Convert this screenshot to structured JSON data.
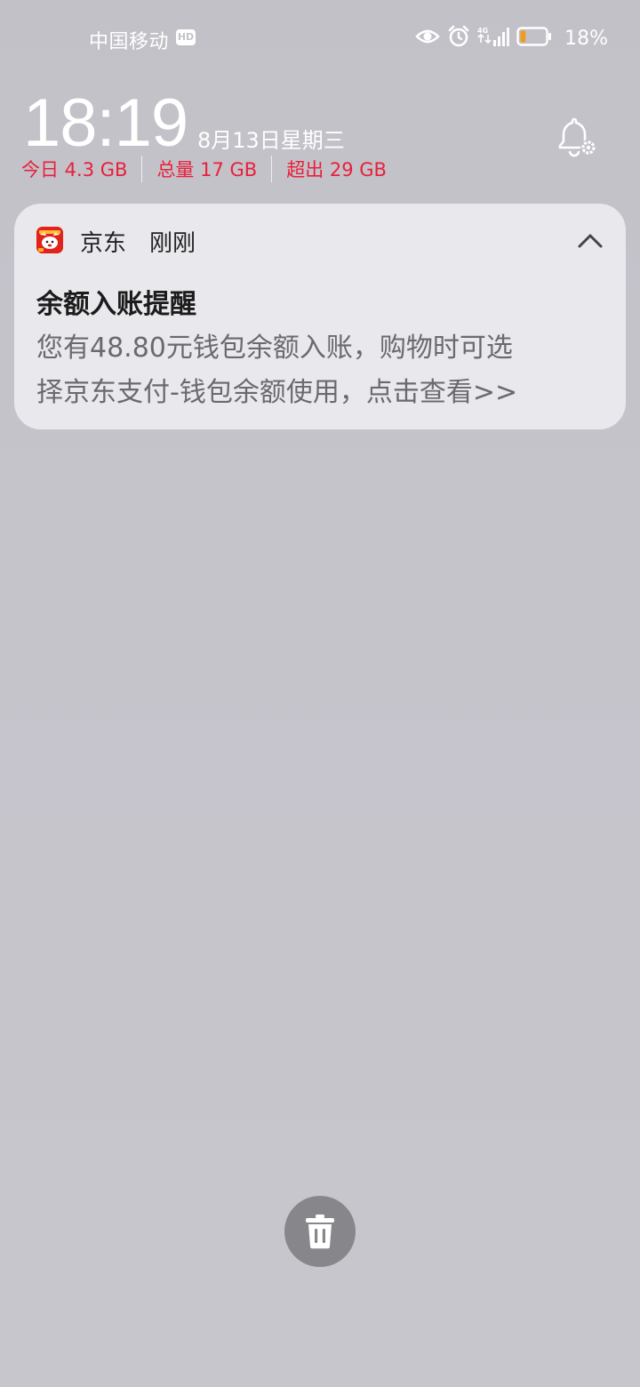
{
  "status_bar": {
    "carrier": "中国移动",
    "hd_label": "HD",
    "network_label": "4G",
    "battery_percent": "18%",
    "battery_level": 0.18,
    "icons": [
      "eye-icon",
      "alarm-icon",
      "signal-icon",
      "battery-icon"
    ]
  },
  "lockscreen": {
    "time": "18:19",
    "date": "8月13日星期三"
  },
  "data_usage": {
    "today": "今日 4.3 GB",
    "total": "总量 17 GB",
    "exceed": "超出 29 GB",
    "color": "#e8203a"
  },
  "notification": {
    "app_name": "京东",
    "time": "刚刚",
    "title": "余额入账提醒",
    "body_line1": "您有48.80元钱包余额入账，购物时可选",
    "body_line2": "择京东支付-钱包余额使用，点击查看>>",
    "app_icon_color": "#e2231a"
  },
  "actions": {
    "clear_all_icon": "trash-icon"
  }
}
